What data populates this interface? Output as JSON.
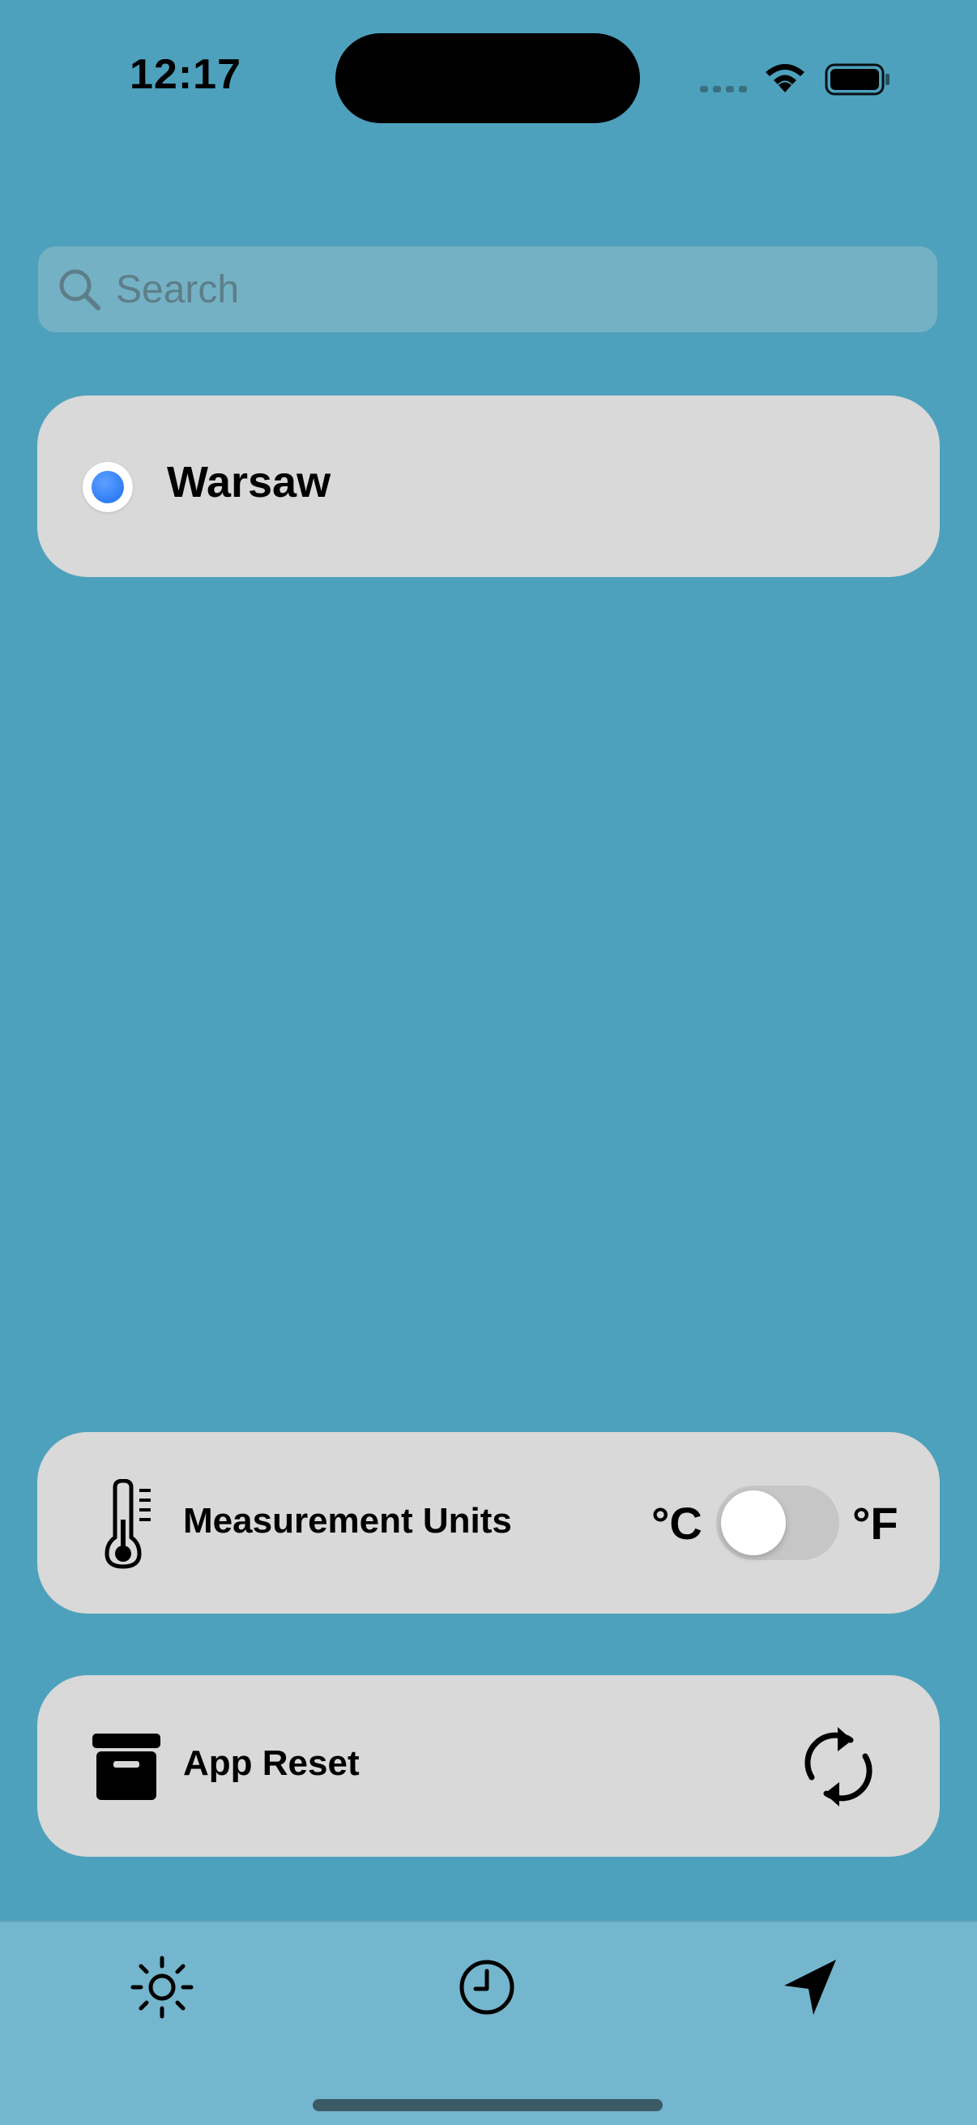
{
  "status_bar": {
    "time": "12:17",
    "icons": [
      "cellular-signal-icon",
      "wifi-icon",
      "battery-icon"
    ]
  },
  "search": {
    "placeholder": "Search",
    "value": ""
  },
  "cities": [
    {
      "name": "Warsaw",
      "selected": true
    }
  ],
  "settings": {
    "units": {
      "label": "Measurement Units",
      "celsius_label": "°C",
      "fahrenheit_label": "°F",
      "is_fahrenheit": false,
      "icon": "thermometer-icon"
    },
    "reset": {
      "label": "App Reset",
      "icon": "archive-icon",
      "action_icon": "refresh-icon"
    }
  },
  "tab_bar": {
    "tabs": [
      {
        "name": "weather",
        "icon": "sun-icon"
      },
      {
        "name": "history",
        "icon": "clock-icon"
      },
      {
        "name": "location",
        "icon": "location-arrow-icon"
      }
    ]
  },
  "colors": {
    "background": "#4ea1bc",
    "card": "#d9d9d9",
    "tab_bar": "#74b6cd",
    "accent": "#1b6ff2"
  }
}
